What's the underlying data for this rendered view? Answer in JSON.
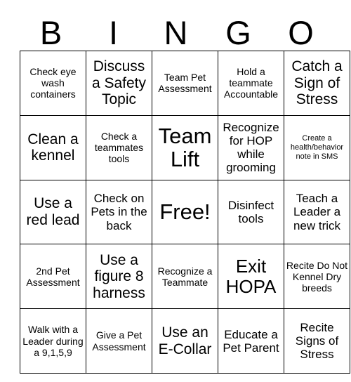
{
  "card": {
    "title": "BINGO",
    "header_letters": [
      "B",
      "I",
      "N",
      "G",
      "O"
    ],
    "columns": 5,
    "rows": 5,
    "free_space_label": "Free!",
    "free_space_position": {
      "row": 3,
      "column": 3
    },
    "colors": {
      "background": "#ffffff",
      "text": "#000000",
      "grid_line": "#000000"
    },
    "cells": [
      [
        {
          "text": "Check eye wash containers",
          "size": "sm",
          "marked": false
        },
        {
          "text": "Discuss a Safety Topic",
          "size": "lg",
          "marked": false
        },
        {
          "text": "Team Pet Assessment",
          "size": "sm",
          "marked": false
        },
        {
          "text": "Hold a teammate Accountable",
          "size": "sm",
          "marked": false
        },
        {
          "text": "Catch a Sign of Stress",
          "size": "lg",
          "marked": false
        }
      ],
      [
        {
          "text": "Clean a kennel",
          "size": "lg",
          "marked": false
        },
        {
          "text": "Check a teammates tools",
          "size": "sm",
          "marked": false
        },
        {
          "text": "Team Lift",
          "size": "xxl",
          "marked": false
        },
        {
          "text": "Recognize for HOP while grooming",
          "size": "md",
          "marked": false
        },
        {
          "text": "Create a health/behavior note in SMS",
          "size": "xs",
          "marked": false
        }
      ],
      [
        {
          "text": "Use a red lead",
          "size": "lg",
          "marked": false
        },
        {
          "text": "Check on Pets in the back",
          "size": "md",
          "marked": false
        },
        {
          "text": "Free!",
          "size": "xxl",
          "marked": false
        },
        {
          "text": "Disinfect tools",
          "size": "md",
          "marked": false
        },
        {
          "text": "Teach a Leader a new trick",
          "size": "md",
          "marked": false
        }
      ],
      [
        {
          "text": "2nd Pet Assessment",
          "size": "sm",
          "marked": false
        },
        {
          "text": "Use a figure 8 harness",
          "size": "lg",
          "marked": false
        },
        {
          "text": "Recognize a Teammate",
          "size": "sm",
          "marked": false
        },
        {
          "text": "Exit HOPA",
          "size": "xl",
          "marked": false
        },
        {
          "text": "Recite Do Not Kennel Dry breeds",
          "size": "sm",
          "marked": false
        }
      ],
      [
        {
          "text": "Walk with a Leader during a 9,1,5,9",
          "size": "sm",
          "marked": false
        },
        {
          "text": "Give a Pet Assessment",
          "size": "sm",
          "marked": false
        },
        {
          "text": "Use an E-Collar",
          "size": "lg",
          "marked": false
        },
        {
          "text": "Educate a Pet Parent",
          "size": "md",
          "marked": false
        },
        {
          "text": "Recite Signs of Stress",
          "size": "md",
          "marked": false
        }
      ]
    ]
  }
}
